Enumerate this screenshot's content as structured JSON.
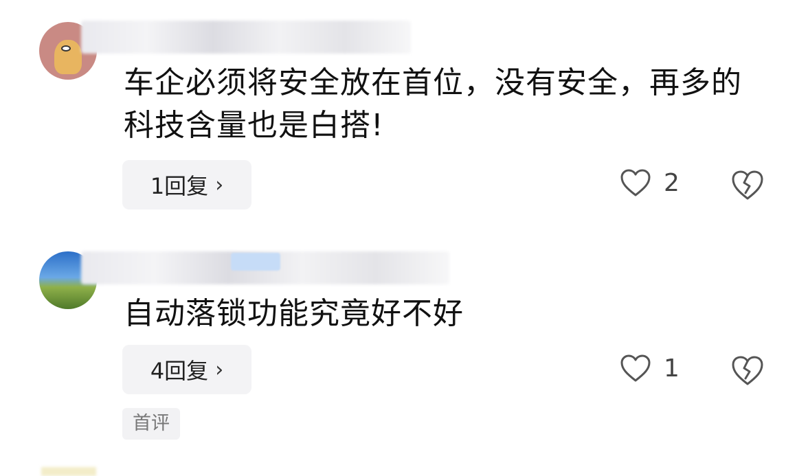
{
  "comments": [
    {
      "text": "车企必须将安全放在首位，没有安全，再多的科技含量也是白搭!",
      "reply_label": "1回复",
      "like_count": "2"
    },
    {
      "text": "自动落锁功能究竟好不好",
      "reply_label": "4回复",
      "like_count": "1",
      "badge": "首评"
    }
  ],
  "icons": {
    "like": "heart-outline-icon",
    "dislike": "broken-heart-icon",
    "reply_chevron": "chevron-right-icon"
  },
  "colors": {
    "text": "#111111",
    "reply_bg": "#f3f3f5",
    "icon": "#555555",
    "badge_text": "#777777"
  }
}
